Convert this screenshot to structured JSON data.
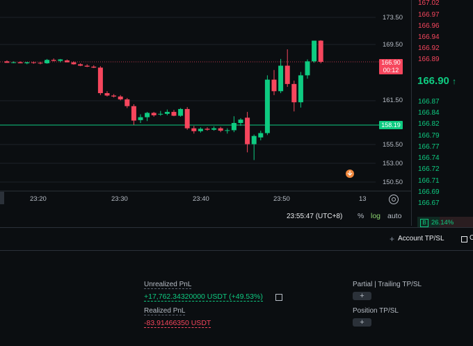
{
  "chart": {
    "y_axis_labels": [
      "173.50",
      "169.50",
      "161.50",
      "155.50",
      "153.00",
      "150.50"
    ],
    "x_axis_labels": [
      "23:20",
      "23:30",
      "23:40",
      "23:50",
      "13"
    ],
    "current_price": "166.90",
    "countdown": "00:12",
    "ma_price": "158.19",
    "time_display": "23:55:47 (UTC+8)",
    "controls": {
      "percent": "%",
      "log": "log",
      "auto": "auto"
    },
    "colors": {
      "up": "#0ecb81",
      "down": "#f6465d",
      "grid": "#1e2329"
    }
  },
  "chart_data": {
    "type": "candlestick",
    "candles": [
      {
        "o": 167.0,
        "h": 167.2,
        "l": 166.7,
        "c": 166.7
      },
      {
        "o": 166.8,
        "h": 167.0,
        "l": 166.6,
        "c": 166.8
      },
      {
        "o": 166.8,
        "h": 167.0,
        "l": 166.6,
        "c": 166.6
      },
      {
        "o": 166.6,
        "h": 166.9,
        "l": 166.4,
        "c": 166.8
      },
      {
        "o": 166.8,
        "h": 167.0,
        "l": 166.5,
        "c": 166.7
      },
      {
        "o": 166.7,
        "h": 166.9,
        "l": 166.4,
        "c": 166.6
      },
      {
        "o": 166.6,
        "h": 167.5,
        "l": 166.5,
        "c": 167.3
      },
      {
        "o": 167.3,
        "h": 167.6,
        "l": 167.0,
        "c": 167.1
      },
      {
        "o": 167.1,
        "h": 167.5,
        "l": 166.8,
        "c": 167.4
      },
      {
        "o": 167.2,
        "h": 167.4,
        "l": 166.8,
        "c": 166.8
      },
      {
        "o": 166.8,
        "h": 167.0,
        "l": 166.3,
        "c": 166.4
      },
      {
        "o": 166.4,
        "h": 166.6,
        "l": 166.0,
        "c": 166.1
      },
      {
        "o": 166.1,
        "h": 166.4,
        "l": 165.8,
        "c": 165.9
      },
      {
        "o": 165.9,
        "h": 166.2,
        "l": 165.6,
        "c": 165.7
      },
      {
        "o": 165.7,
        "h": 166.0,
        "l": 160.0,
        "c": 160.4
      },
      {
        "o": 160.4,
        "h": 160.8,
        "l": 159.7,
        "c": 159.9
      },
      {
        "o": 159.9,
        "h": 160.2,
        "l": 159.5,
        "c": 159.7
      },
      {
        "o": 159.7,
        "h": 160.0,
        "l": 158.9,
        "c": 159.1
      },
      {
        "o": 159.1,
        "h": 159.4,
        "l": 157.3,
        "c": 157.7
      },
      {
        "o": 157.7,
        "h": 158.1,
        "l": 153.8,
        "c": 154.7
      },
      {
        "o": 154.8,
        "h": 156.0,
        "l": 154.2,
        "c": 155.4
      },
      {
        "o": 155.4,
        "h": 156.5,
        "l": 154.6,
        "c": 156.3
      },
      {
        "o": 156.3,
        "h": 156.5,
        "l": 155.5,
        "c": 155.8
      },
      {
        "o": 156.0,
        "h": 156.7,
        "l": 155.7,
        "c": 156.1
      },
      {
        "o": 156.1,
        "h": 157.0,
        "l": 155.8,
        "c": 156.5
      },
      {
        "o": 156.5,
        "h": 156.9,
        "l": 155.6,
        "c": 155.7
      },
      {
        "o": 155.7,
        "h": 157.3,
        "l": 155.5,
        "c": 157.1
      },
      {
        "o": 157.1,
        "h": 157.5,
        "l": 152.8,
        "c": 153.1
      },
      {
        "o": 153.1,
        "h": 153.6,
        "l": 152.0,
        "c": 152.5
      },
      {
        "o": 152.5,
        "h": 153.3,
        "l": 152.2,
        "c": 153.0
      },
      {
        "o": 153.0,
        "h": 153.3,
        "l": 152.6,
        "c": 152.8
      },
      {
        "o": 152.8,
        "h": 153.5,
        "l": 152.6,
        "c": 153.1
      },
      {
        "o": 153.1,
        "h": 153.4,
        "l": 152.3,
        "c": 152.6
      },
      {
        "o": 152.6,
        "h": 153.1,
        "l": 152.0,
        "c": 152.7
      },
      {
        "o": 152.7,
        "h": 155.6,
        "l": 152.3,
        "c": 154.2
      },
      {
        "o": 154.2,
        "h": 155.2,
        "l": 153.6,
        "c": 154.9
      },
      {
        "o": 155.3,
        "h": 156.5,
        "l": 148.1,
        "c": 149.8
      },
      {
        "o": 149.8,
        "h": 151.8,
        "l": 146.5,
        "c": 151.5
      },
      {
        "o": 151.2,
        "h": 152.6,
        "l": 150.6,
        "c": 152.1
      },
      {
        "o": 152.1,
        "h": 164.1,
        "l": 151.7,
        "c": 163.2
      },
      {
        "o": 163.2,
        "h": 165.2,
        "l": 160.0,
        "c": 160.8
      },
      {
        "o": 160.8,
        "h": 167.5,
        "l": 160.4,
        "c": 166.1
      },
      {
        "o": 166.1,
        "h": 169.5,
        "l": 161.7,
        "c": 162.3
      },
      {
        "o": 162.3,
        "h": 163.0,
        "l": 156.6,
        "c": 158.5
      },
      {
        "o": 158.5,
        "h": 164.8,
        "l": 157.4,
        "c": 164.1
      },
      {
        "o": 164.1,
        "h": 167.4,
        "l": 163.4,
        "c": 167.0
      },
      {
        "o": 167.0,
        "h": 171.3,
        "l": 166.7,
        "c": 171.3
      },
      {
        "o": 171.3,
        "h": 171.4,
        "l": 166.6,
        "c": 166.9
      }
    ]
  },
  "orderbook": {
    "asks": [
      "167.02",
      "166.97",
      "166.96",
      "166.94",
      "166.92",
      "166.89"
    ],
    "last_price": "166.90",
    "last_arrow": "↑",
    "bids": [
      "166.87",
      "166.84",
      "166.82",
      "166.79",
      "166.77",
      "166.74",
      "166.72",
      "166.71",
      "166.69",
      "166.67"
    ],
    "buy_badge": "B",
    "buy_pct": "26.14%",
    "buy_ratio": 0.4
  },
  "tabs_bar": {
    "account_tpsl": "Account TP/SL",
    "close_label": "C"
  },
  "pnl": {
    "unrealized_label": "Unrealized PnL",
    "unrealized_value": "+17,762.34320000 USDT (+49.53%)",
    "realized_label": "Realized PnL",
    "realized_value": "-83.91466350 USDT"
  },
  "tpsl": {
    "partial_label": "Partial | Trailing TP/SL",
    "position_label": "Position TP/SL",
    "add_symbol": "+"
  }
}
